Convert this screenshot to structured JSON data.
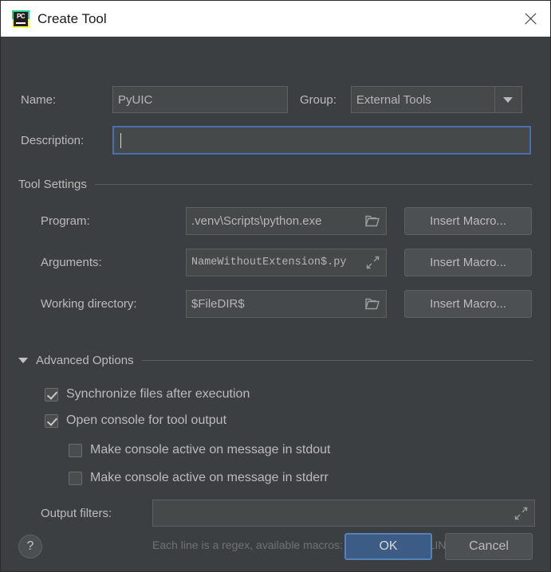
{
  "window": {
    "title": "Create Tool",
    "icon": "pycharm-icon",
    "close_label": "×"
  },
  "form": {
    "name_label": "Name:",
    "name_value": "PyUIC",
    "group_label": "Group:",
    "group_value": "External Tools",
    "description_label": "Description:",
    "description_value": ""
  },
  "tool_settings": {
    "section_title": "Tool Settings",
    "rows": [
      {
        "label": "Program:",
        "value": ".venv\\Scripts\\python.exe",
        "icon": "folder-icon",
        "button": "Insert Macro..."
      },
      {
        "label": "Arguments:",
        "value": "NameWithoutExtension$.py",
        "icon": "expand-icon",
        "button": "Insert Macro..."
      },
      {
        "label": "Working directory:",
        "value": "$FileDIR$",
        "icon": "folder-icon",
        "button": "Insert Macro..."
      }
    ]
  },
  "advanced": {
    "section_title": "Advanced Options",
    "expanded": true,
    "checkboxes": [
      {
        "label": "Synchronize files after execution",
        "checked": true
      },
      {
        "label": "Open console for tool output",
        "checked": true
      },
      {
        "label": "Make console active on message in stdout",
        "checked": false
      },
      {
        "label": "Make console active on message in stderr",
        "checked": false
      }
    ],
    "output_filters_label": "Output filters:",
    "output_filters_value": "",
    "output_filters_hint": "Each line is a regex, available macros: $FILE_PATH$, $LINE$..",
    "output_filters_icon": "expand-icon"
  },
  "footer": {
    "help_label": "?",
    "ok_label": "OK",
    "cancel_label": "Cancel"
  },
  "colors": {
    "dialog_bg": "#3c3f41",
    "titlebar_bg": "#ffffff",
    "field_bg": "#45494a",
    "focus_border": "#4b6eaf",
    "primary_button": "#3c5c85",
    "text": "#bbbbbb",
    "hint_text": "#6f7274"
  }
}
